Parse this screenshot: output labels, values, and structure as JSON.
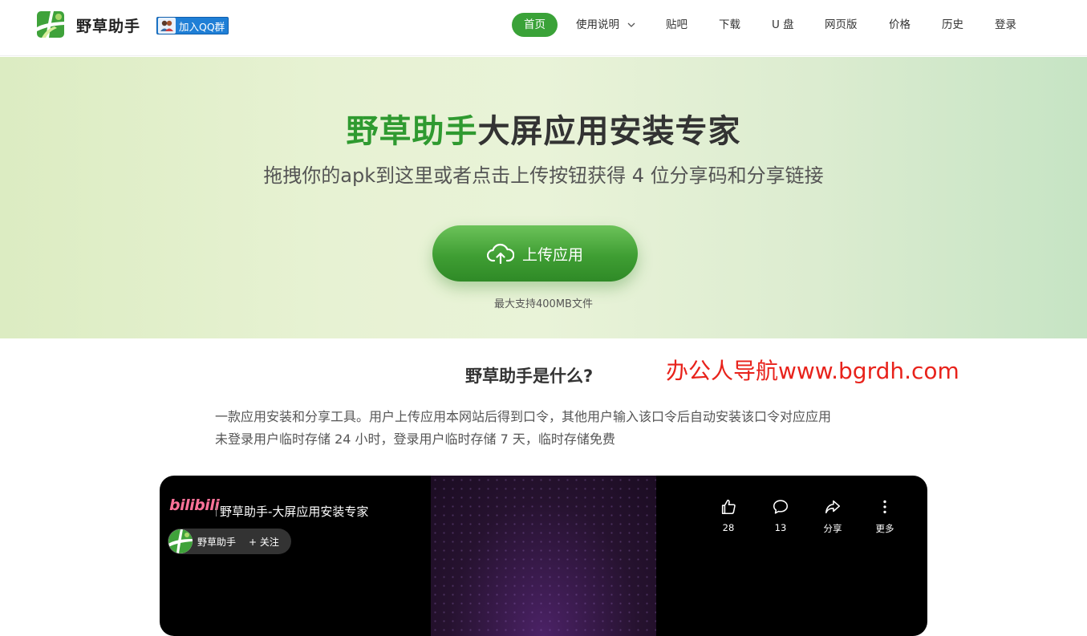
{
  "header": {
    "brand": "野草助手",
    "qq_button": "加入QQ群",
    "nav": [
      {
        "label": "首页"
      },
      {
        "label": "使用说明"
      },
      {
        "label": "贴吧"
      },
      {
        "label": "下载"
      },
      {
        "label": "U 盘"
      },
      {
        "label": "网页版"
      },
      {
        "label": "价格"
      },
      {
        "label": "历史"
      },
      {
        "label": "登录"
      }
    ]
  },
  "hero": {
    "title_green": "野草助手",
    "title_dark": "大屏应用安装专家",
    "subtitle": "拖拽你的apk到这里或者点击上传按钮获得 4 位分享码和分享链接",
    "upload_label": "上传应用",
    "note": "最大支持400MB文件"
  },
  "about": {
    "title": "野草助手是什么?",
    "watermark": "办公人导航www.bgrdh.com",
    "lines": [
      "一款应用安装和分享工具。用户上传应用本网站后得到口令，其他用户输入该口令后自动安装该口令对应应用",
      "未登录用户临时存储 24 小时，登录用户临时存储 7 天，临时存储免费"
    ]
  },
  "video": {
    "platform": "bilibili",
    "title": "野草助手-大屏应用安装专家",
    "uploader": "野草助手",
    "follow": "+ 关注",
    "actions": [
      {
        "icon": "thumbs-up-icon",
        "label": "28"
      },
      {
        "icon": "comment-icon",
        "label": "13"
      },
      {
        "icon": "share-icon",
        "label": "分享"
      },
      {
        "icon": "more-icon",
        "label": "更多"
      }
    ]
  },
  "colors": {
    "accent_green": "#3aa238",
    "title_green": "#2f9a30",
    "qq_blue": "#1f7fd6",
    "bilibili_pink": "#fb7299",
    "watermark_red": "#e8221b"
  }
}
